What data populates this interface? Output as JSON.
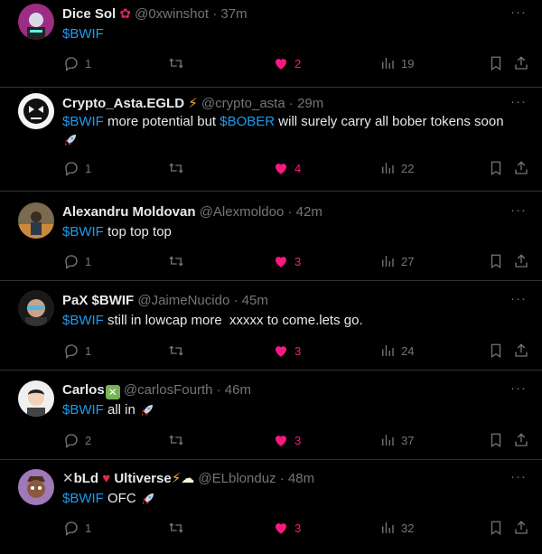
{
  "tweets": [
    {
      "name": "Dice Sol",
      "handle": "@0xwinshot",
      "time": "37m",
      "text_pre": "",
      "cash1": "$BWIF",
      "text_mid": "",
      "cash2": "",
      "text_post": "",
      "replies": "1",
      "likes": "2",
      "views": "19",
      "badge": "rose",
      "badge_color": "#e0245e"
    },
    {
      "name": "Crypto_Asta.EGLD",
      "handle": "@crypto_asta",
      "time": "29m",
      "text_pre": "",
      "cash1": "$BWIF",
      "text_mid": " more potential but ",
      "cash2": "$BOBER",
      "text_post": " will surely carry all bober tokens soon",
      "replies": "1",
      "likes": "4",
      "views": "22",
      "badge": "lightning",
      "badge_color": "#ffac33"
    },
    {
      "name": "Alexandru Moldovan",
      "handle": "@Alexmoldoo",
      "time": "42m",
      "text_pre": "",
      "cash1": "$BWIF",
      "text_mid": " top top top",
      "cash2": "",
      "text_post": "",
      "replies": "1",
      "likes": "3",
      "views": "27",
      "badge": "",
      "badge_color": ""
    },
    {
      "name": "PaX $BWIF",
      "handle": "@JaimeNucido",
      "time": "45m",
      "text_pre": "",
      "cash1": "$BWIF",
      "text_mid": " still in lowcap more  xxxxx to come.lets go.",
      "cash2": "",
      "text_post": "",
      "replies": "1",
      "likes": "3",
      "views": "24",
      "badge": "",
      "badge_color": ""
    },
    {
      "name": "Carlos",
      "handle": "@carlosFourth",
      "time": "46m",
      "text_pre": "",
      "cash1": "$BWIF",
      "text_mid": " all in ",
      "cash2": "",
      "text_post": "",
      "replies": "2",
      "likes": "3",
      "views": "37",
      "badge": "check-box",
      "badge_color": "#77b255"
    },
    {
      "name": "bLd",
      "name2": "Ultiverse",
      "handle": "@ELblonduz",
      "time": "48m",
      "text_pre": "",
      "cash1": "$BWIF",
      "text_mid": " OFC ",
      "cash2": "",
      "text_post": "",
      "replies": "1",
      "likes": "3",
      "views": "32",
      "badge": "lightning-sheep",
      "badge_color": "#ffac33"
    }
  ],
  "separator": "·",
  "more_label": "···",
  "colors": {
    "accent": "#1d9bf0",
    "like": "#f91880",
    "muted": "#71767b",
    "text": "#e7e9ea",
    "border": "#2f3336"
  },
  "icons": {
    "reply": "reply-icon",
    "retweet": "retweet-icon",
    "like": "heart-icon",
    "views": "views-icon",
    "bookmark": "bookmark-icon",
    "share": "share-icon",
    "more": "more-icon",
    "rocket": "rocket-icon"
  }
}
